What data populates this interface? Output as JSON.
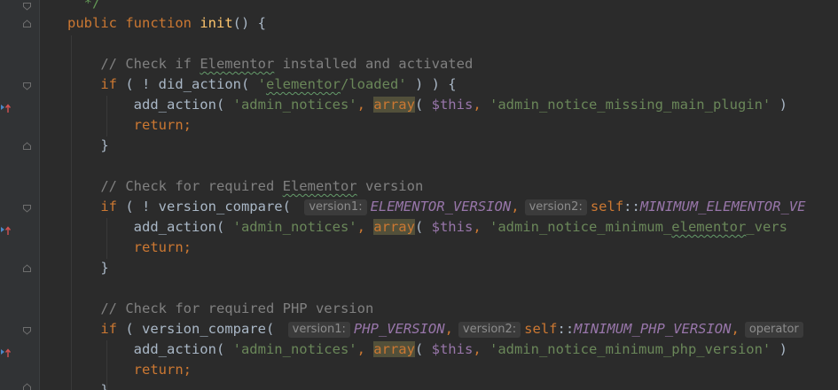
{
  "editor": {
    "colors": {
      "background": "#2b2b2b",
      "keyword": "#cc7832",
      "function": "#ffc66d",
      "string": "#6a8759",
      "comment": "#808080",
      "variable": "#9876aa"
    },
    "hint_labels": {
      "version1": "version1:",
      "version2": "version2:",
      "operator": "operator"
    },
    "lines": {
      "l0": {
        "doc_end": "*/"
      },
      "l1": {
        "public": "public",
        "function": "function",
        "name": "init",
        "rest": "() {"
      },
      "l3": {
        "comment_a": "// Check if ",
        "comment_b": "Elementor",
        "comment_c": " installed and activated"
      },
      "l4": {
        "if": "if",
        "a": " ( ! did_action( ",
        "str_q1": "'",
        "str_b": "elementor",
        "str_c": "/loaded'",
        "b": " ) ) {"
      },
      "l5": {
        "a": "add_action( ",
        "str1": "'admin_notices'",
        "comma": ", ",
        "array": "array",
        "paren": "( ",
        "this": "$this",
        "comma2": ", ",
        "str2": "'admin_notice_missing_main_plugin'",
        "end": " )"
      },
      "l6": {
        "return": "return",
        "semi": ";"
      },
      "l7": {
        "brace": "}"
      },
      "l9": {
        "comment_a": "// Check for required ",
        "comment_b": "Elementor",
        "comment_c": " version"
      },
      "l10": {
        "if": "if",
        "a": " ( ! version_compare( ",
        "const1": "ELEMENTOR_VERSION",
        "comma": ",",
        "self": "self",
        "dc": "::",
        "const2": "MINIMUM_ELEMENTOR_VE"
      },
      "l11": {
        "a": "add_action( ",
        "str1": "'admin_notices'",
        "comma": ", ",
        "array": "array",
        "paren": "( ",
        "this": "$this",
        "comma2": ", ",
        "str2a": "'admin_notice_minimum_",
        "str2b": "elementor",
        "str2c": "_vers"
      },
      "l12": {
        "return": "return",
        "semi": ";"
      },
      "l13": {
        "brace": "}"
      },
      "l15": {
        "comment": "// Check for required PHP version"
      },
      "l16": {
        "if": "if",
        "a": " ( version_compare( ",
        "const1": "PHP_VERSION",
        "comma": ",",
        "self": "self",
        "dc": "::",
        "const2": "MINIMUM_PHP_VERSION",
        "comma2": ","
      },
      "l17": {
        "a": "add_action( ",
        "str1": "'admin_notices'",
        "comma": ", ",
        "array": "array",
        "paren": "( ",
        "this": "$this",
        "comma2": ", ",
        "str2": "'admin_notice_minimum_php_version'",
        "end": " )"
      },
      "l18": {
        "return": "return",
        "semi": ";"
      },
      "l19": {
        "brace": "}"
      }
    }
  }
}
